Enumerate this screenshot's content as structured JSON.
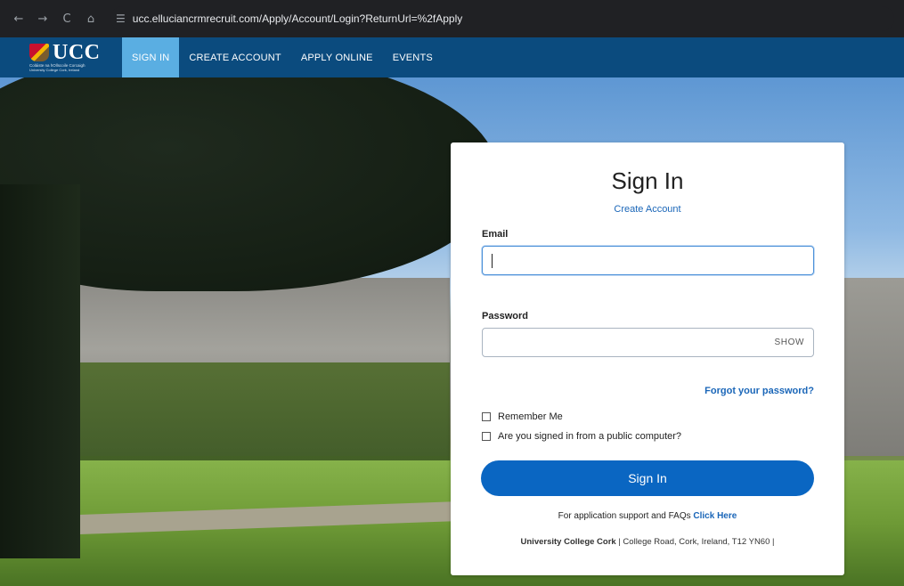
{
  "browser": {
    "back_icon": "←",
    "forward_icon": "→",
    "reload_icon": "C",
    "home_icon": "⌂",
    "site_info_icon": "☰",
    "url": "ucc.elluciancrmrecruit.com/Apply/Account/Login?ReturnUrl=%2fApply"
  },
  "site_nav": {
    "logo_text": "UCC",
    "logo_subtitle": "Coláiste na hOllscoile Corcaigh",
    "logo_subtitle2": "University College Cork, Ireland",
    "items": [
      {
        "label": "SIGN IN",
        "active": true
      },
      {
        "label": "CREATE ACCOUNT",
        "active": false
      },
      {
        "label": "APPLY ONLINE",
        "active": false
      },
      {
        "label": "EVENTS",
        "active": false
      }
    ]
  },
  "signin_card": {
    "title": "Sign In",
    "create_account_link": "Create Account",
    "email_label": "Email",
    "email_value": "",
    "password_label": "Password",
    "password_value": "",
    "show_label": "SHOW",
    "forgot_link": "Forgot your password?",
    "remember_me": "Remember Me",
    "public_computer": "Are you signed in from a public computer?",
    "submit_label": "Sign In",
    "support_text": "For application support and FAQs",
    "support_link": "Click Here",
    "footer_org": "University College Cork",
    "footer_address": " | College Road, Cork, Ireland, T12 YN60 |"
  },
  "colors": {
    "nav_bg": "#0b4b7e",
    "nav_active": "#5aaee2",
    "primary_button": "#0a66c2",
    "link": "#1a66b8"
  }
}
